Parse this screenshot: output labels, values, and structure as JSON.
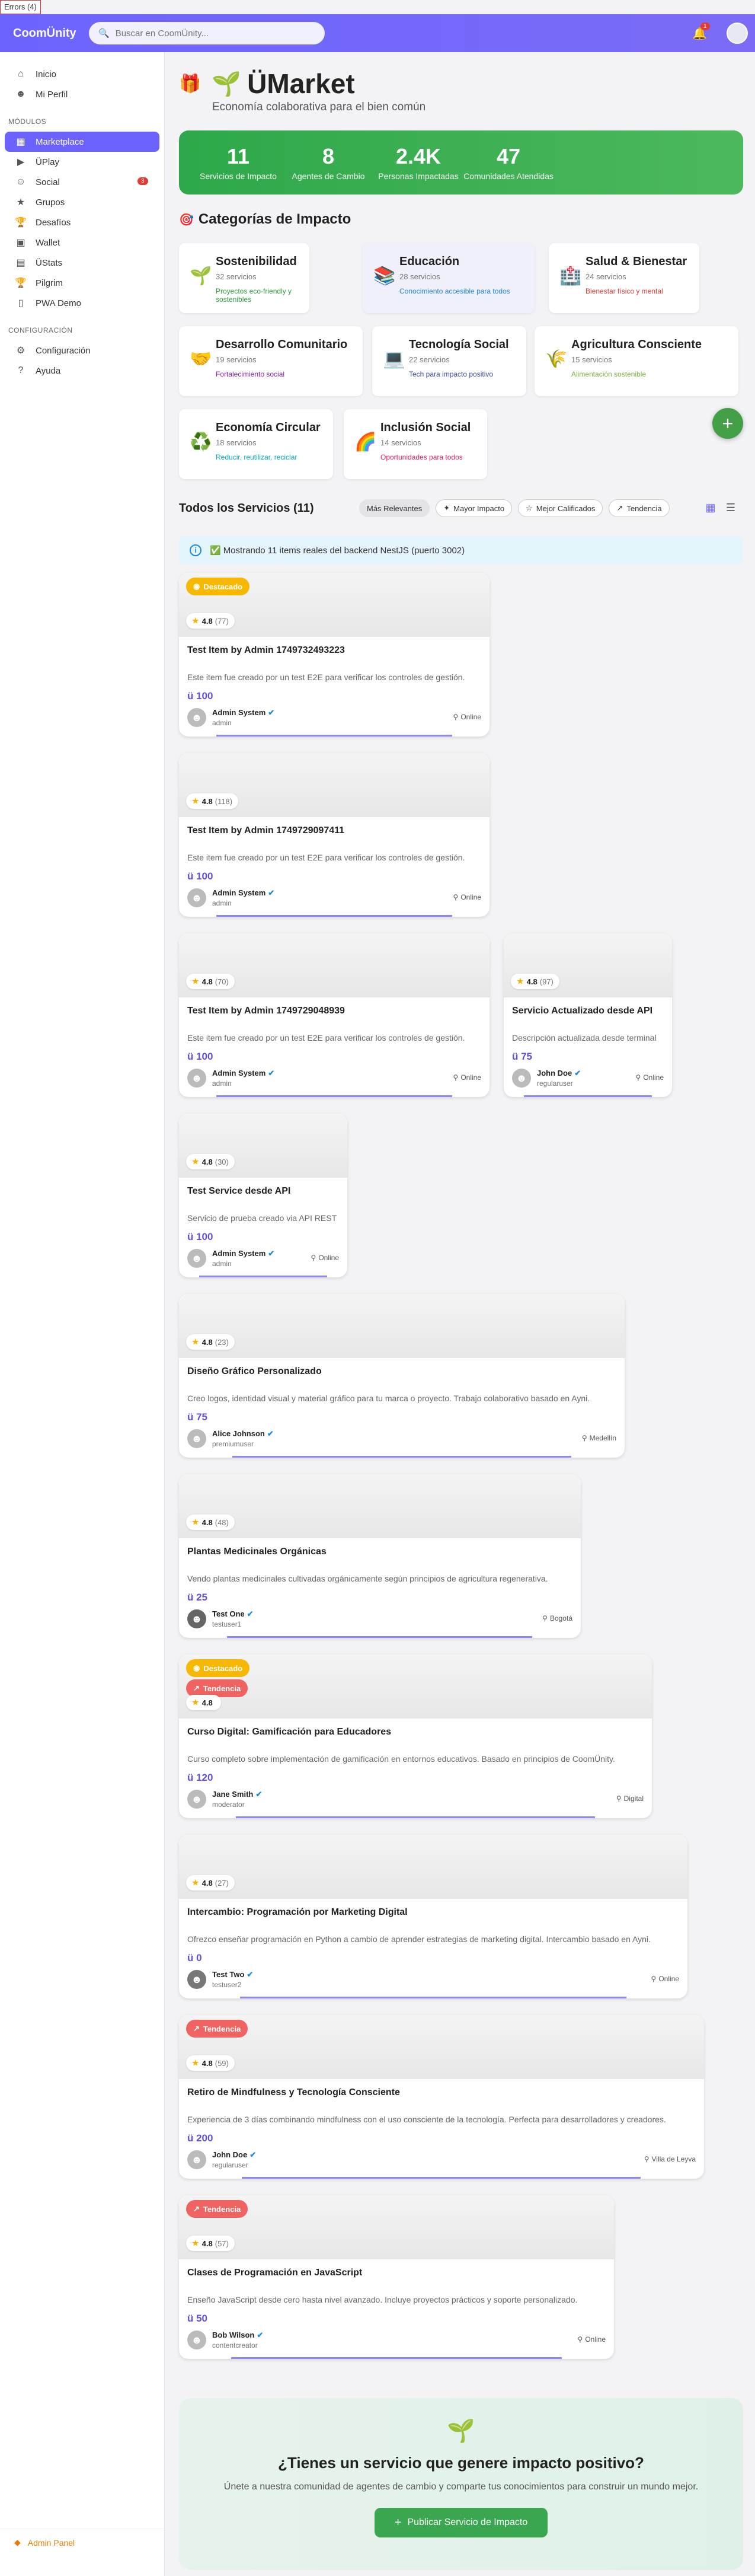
{
  "errors_label": "Errors (4)",
  "brand": "CoomÜnity",
  "search": {
    "placeholder": "Buscar en CoomÜnity..."
  },
  "notifications_count": "1",
  "sidebar": {
    "items": [
      {
        "label": "Inicio",
        "icon": "home-icon"
      },
      {
        "label": "Mi Perfil",
        "icon": "person-icon"
      }
    ],
    "modules_title": "MÓDULOS",
    "modules": [
      {
        "label": "Marketplace",
        "icon": "store-icon"
      },
      {
        "label": "ÜPlay",
        "icon": "play-icon"
      },
      {
        "label": "Social",
        "icon": "people-icon",
        "badge": "3"
      },
      {
        "label": "Grupos",
        "icon": "groups-icon"
      },
      {
        "label": "Desafíos",
        "icon": "trophy-icon"
      },
      {
        "label": "Wallet",
        "icon": "wallet-icon"
      },
      {
        "label": "ÜStats",
        "icon": "stats-icon"
      },
      {
        "label": "Pilgrim",
        "icon": "trophy-icon"
      },
      {
        "label": "PWA Demo",
        "icon": "phone-icon"
      }
    ],
    "config_title": "CONFIGURACIÓN",
    "config": [
      {
        "label": "Configuración",
        "icon": "gear-icon"
      },
      {
        "label": "Ayuda",
        "icon": "help-icon"
      }
    ],
    "footer": "Admin Panel"
  },
  "hero": {
    "title": "ÜMarket",
    "subtitle": "Economía colaborativa para el bien común"
  },
  "stats": [
    {
      "value": "11",
      "label": "Servicios de Impacto"
    },
    {
      "value": "8",
      "label": "Agentes de Cambio"
    },
    {
      "value": "2.4K",
      "label": "Personas Impactadas"
    },
    {
      "value": "47",
      "label": "Comunidades Atendidas"
    }
  ],
  "categories_title": "Categorías de Impacto",
  "categories": [
    {
      "name": "Sostenibilidad",
      "count": "32 servicios",
      "desc": "Proyectos eco-friendly y sostenibles",
      "color": "#2e9e3f",
      "icon": "🌱"
    },
    {
      "name": "Educación",
      "count": "28 servicios",
      "desc": "Conocimiento accesible para todos",
      "color": "#1e88e5",
      "icon": "📚"
    },
    {
      "name": "Salud & Bienestar",
      "count": "24 servicios",
      "desc": "Bienestar físico y mental",
      "color": "#e53935",
      "icon": "🏥"
    },
    {
      "name": "Desarrollo Comunitario",
      "count": "19 servicios",
      "desc": "Fortalecimiento social",
      "color": "#8e24aa",
      "icon": "🤝"
    },
    {
      "name": "Tecnología Social",
      "count": "22 servicios",
      "desc": "Tech para impacto positivo",
      "color": "#3949ab",
      "icon": "💻"
    },
    {
      "name": "Agricultura Consciente",
      "count": "15 servicios",
      "desc": "Alimentación sostenible",
      "color": "#7cb342",
      "icon": "🌾"
    },
    {
      "name": "Economía Circular",
      "count": "18 servicios",
      "desc": "Reducir, reutilizar, reciclar",
      "color": "#00acc1",
      "icon": "♻️"
    },
    {
      "name": "Inclusión Social",
      "count": "14 servicios",
      "desc": "Oportunidades para todos",
      "color": "#e91e63",
      "icon": "🌈"
    }
  ],
  "services_title": "Todos los Servicios (11)",
  "sort": [
    "Más Relevantes",
    "Mayor Impacto",
    "Mejor Calificados",
    "Tendencia"
  ],
  "info": "Mostrando 11 items reales del backend NestJS (puerto 3002)",
  "cards": [
    {
      "badges": [
        "Destacado"
      ],
      "rating": "4.8",
      "reviews": "(77)",
      "title": "Test Item by Admin 1749732493223",
      "desc": "Este item fue creado por un test E2E para verificar los controles de gestión.",
      "price": "ü 100",
      "name": "Admin System",
      "role": "admin",
      "loc": "Online"
    },
    {
      "badges": [],
      "rating": "4.8",
      "reviews": "(118)",
      "title": "Test Item by Admin 1749729097411",
      "desc": "Este item fue creado por un test E2E para verificar los controles de gestión.",
      "price": "ü 100",
      "name": "Admin System",
      "role": "admin",
      "loc": "Online"
    },
    {
      "badges": [],
      "rating": "4.8",
      "reviews": "(70)",
      "title": "Test Item by Admin 1749729048939",
      "desc": "Este item fue creado por un test E2E para verificar los controles de gestión.",
      "price": "ü 100",
      "name": "Admin System",
      "role": "admin",
      "loc": "Online"
    },
    {
      "badges": [],
      "rating": "4.8",
      "reviews": "(97)",
      "title": "Servicio Actualizado desde API",
      "desc": "Descripción actualizada desde terminal",
      "price": "ü 75",
      "name": "John Doe",
      "role": "regularuser",
      "loc": "Online"
    },
    {
      "badges": [],
      "rating": "4.8",
      "reviews": "(30)",
      "title": "Test Service desde API",
      "desc": "Servicio de prueba creado via API REST",
      "price": "ü 100",
      "name": "Admin System",
      "role": "admin",
      "loc": "Online"
    },
    {
      "badges": [],
      "rating": "4.8",
      "reviews": "(23)",
      "title": "Diseño Gráfico Personalizado",
      "desc": "Creo logos, identidad visual y material gráfico para tu marca o proyecto. Trabajo colaborativo basado en Ayni.",
      "price": "ü 75",
      "name": "Alice Johnson",
      "role": "premiumuser",
      "loc": "Medellín"
    },
    {
      "badges": [],
      "rating": "4.8",
      "reviews": "(48)",
      "title": "Plantas Medicinales Orgánicas",
      "desc": "Vendo plantas medicinales cultivadas orgánicamente según principios de agricultura regenerativa.",
      "price": "ü 25",
      "name": "Test One",
      "role": "testuser1",
      "loc": "Bogotá"
    },
    {
      "badges": [
        "Destacado",
        "Tendencia"
      ],
      "rating": "4.8",
      "reviews": "",
      "title": "Curso Digital: Gamificación para Educadores",
      "desc": "Curso completo sobre implementación de gamificación en entornos educativos. Basado en principios de CoomÜnity.",
      "price": "ü 120",
      "name": "Jane Smith",
      "role": "moderator",
      "loc": "Digital"
    },
    {
      "badges": [],
      "rating": "4.8",
      "reviews": "(27)",
      "title": "Intercambio: Programación por Marketing Digital",
      "desc": "Ofrezco enseñar programación en Python a cambio de aprender estrategias de marketing digital. Intercambio basado en Ayni.",
      "price": "ü 0",
      "name": "Test Two",
      "role": "testuser2",
      "loc": "Online"
    },
    {
      "badges": [
        "Tendencia"
      ],
      "rating": "4.8",
      "reviews": "(59)",
      "title": "Retiro de Mindfulness y Tecnología Consciente",
      "desc": "Experiencia de 3 días combinando mindfulness con el uso consciente de la tecnología. Perfecta para desarrolladores y creadores.",
      "price": "ü 200",
      "name": "John Doe",
      "role": "regularuser",
      "loc": "Villa de Leyva"
    },
    {
      "badges": [
        "Tendencia"
      ],
      "rating": "4.8",
      "reviews": "(57)",
      "title": "Clases de Programación en JavaScript",
      "desc": "Enseño JavaScript desde cero hasta nivel avanzado. Incluye proyectos prácticos y soporte personalizado.",
      "price": "ü 50",
      "name": "Bob Wilson",
      "role": "contentcreator",
      "loc": "Online"
    }
  ],
  "cta": {
    "title": "¿Tienes un servicio que genere impacto positivo?",
    "text": "Únete a nuestra comunidad de agentes de cambio y comparte tus conocimientos para construir un mundo mejor.",
    "button": "Publicar Servicio de Impacto"
  }
}
